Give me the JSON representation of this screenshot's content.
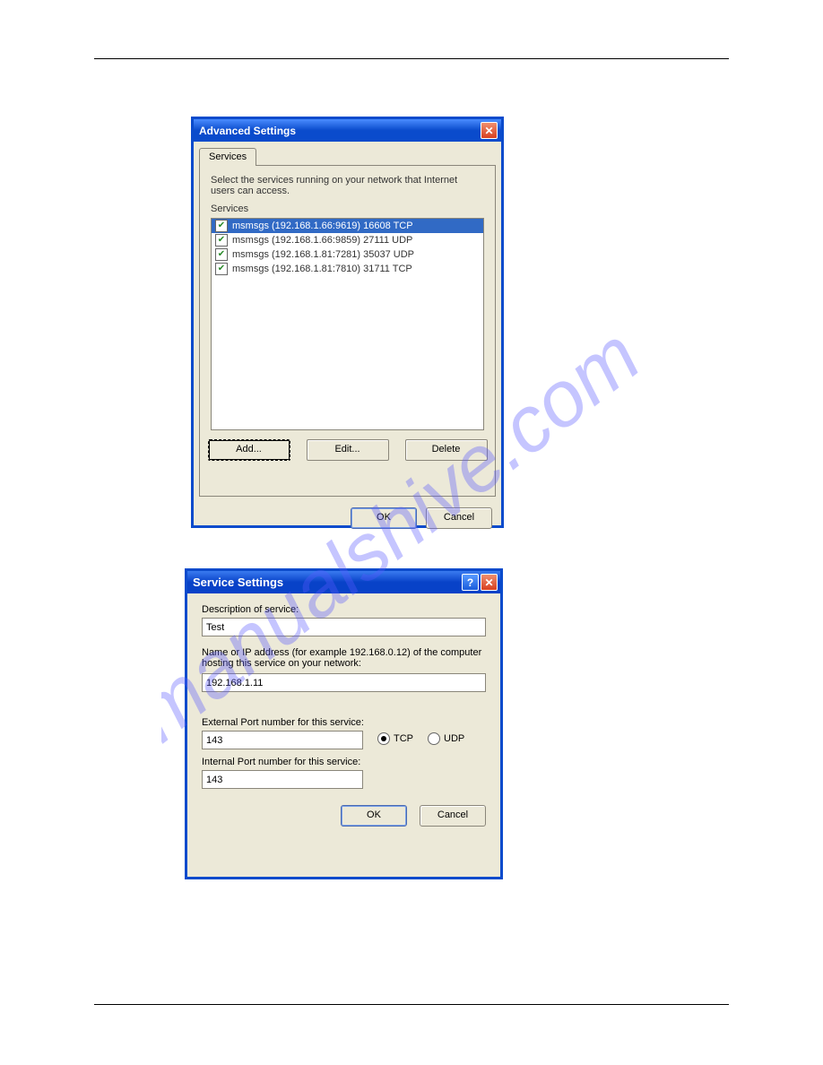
{
  "dialog1": {
    "title": "Advanced Settings",
    "tab_label": "Services",
    "instruction": "Select the services running on your network that Internet users can access.",
    "group_label": "Services",
    "items": [
      "msmsgs (192.168.1.66:9619) 16608 TCP",
      "msmsgs (192.168.1.66:9859) 27111 UDP",
      "msmsgs (192.168.1.81:7281) 35037 UDP",
      "msmsgs (192.168.1.81:7810) 31711 TCP"
    ],
    "btn_add": "Add...",
    "btn_edit": "Edit...",
    "btn_delete": "Delete",
    "btn_ok": "OK",
    "btn_cancel": "Cancel"
  },
  "dialog2": {
    "title": "Service Settings",
    "lbl_desc": "Description of service:",
    "val_desc": "Test",
    "lbl_host": "Name or IP address (for example 192.168.0.12) of the computer hosting this service on your network:",
    "val_host": "192.168.1.11",
    "lbl_ext": "External Port number for this service:",
    "val_ext": "143",
    "radio_tcp": "TCP",
    "radio_udp": "UDP",
    "lbl_int": "Internal Port number for this service:",
    "val_int": "143",
    "btn_ok": "OK",
    "btn_cancel": "Cancel"
  }
}
